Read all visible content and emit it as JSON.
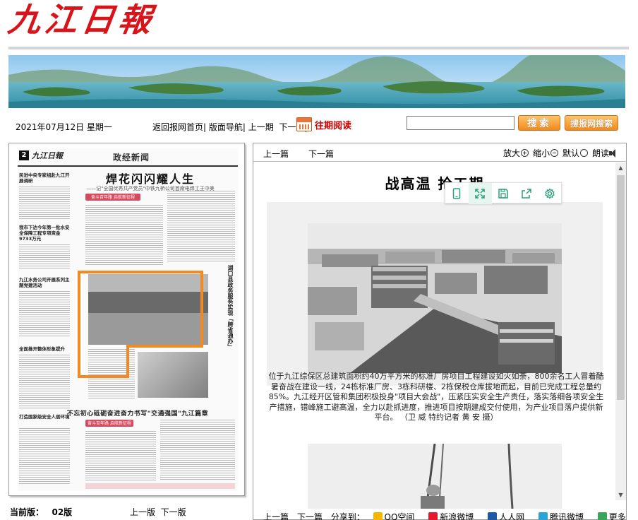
{
  "masthead": {
    "logo": "九江日報"
  },
  "topnav": {
    "date": "2021年07月12日 星期一",
    "links": [
      "返回报网首页|",
      "版面导航|",
      "上一期",
      "下一期|"
    ],
    "archive_label": "往期阅读",
    "search_value": "",
    "search_button": "搜索",
    "site_search_button": "搜报网搜索"
  },
  "newspage": {
    "page_num": "2",
    "logo": "九江日報",
    "section": "政经新闻",
    "headline": "焊花闪闪耀人生",
    "subhead": "——记\"全国优秀共产党员\"中铁九桥公司首席电焊工王中美",
    "side_heads": [
      "民进中央专家组赴九江开展调研",
      "我市下达今年第一批水安全保障工程专项资金9733万元",
      "九江水务公司开展系列主题党建活动",
      "全面推开整体形象提升",
      "打造国家级安全人居环境"
    ],
    "red_boxes": [
      "奋斗百年路 启航新征程",
      "奋斗百年路 启航新征程"
    ],
    "vertical_head": "湖口县政务服务实现「跨省通办」",
    "bottom_head": "不忘初心砥砺奋进奋力书写\"交通强国\"九江篇章"
  },
  "version": {
    "label": "当前版：",
    "value": "02版",
    "prev": "上一版",
    "next": "下一版"
  },
  "article_bar": {
    "prev": "上一篇",
    "next": "下一篇",
    "zoom_in": "放大",
    "zoom_out": "缩小",
    "default": "默认",
    "read": "朗读"
  },
  "article": {
    "title": "战高温 抢工期",
    "caption": "位于九江综保区总建筑面积约40万平方米的标准厂房项目工程建设如火如荼，800余名工人冒着酷暑奋战在建设一线，24栋标准厂房、3栋科研楼、2栋保税仓库拔地而起，目前已完成工程总量约85%。九江经开区管和集团积极投身\"项目大会战\"，压紧压实安全生产责任，落实落细各项安全生产措施，错峰施工避高温，全力以赴抓进度，推进项目按期建成交付使用，为产业项目落户提供新平台。 （卫 威 特约记者 黄 安 摄）"
  },
  "floating_tools": [
    "phone-icon",
    "fullscreen-icon",
    "save-icon",
    "share-icon",
    "gear-icon"
  ],
  "bottom_bar": {
    "prev": "上一篇",
    "next": "下一篇",
    "share_label": "分享到：",
    "shares": [
      "QQ空间",
      "新浪微博",
      "人人网",
      "腾讯微博",
      "更多"
    ]
  },
  "colors": {
    "brand_red": "#d8141a",
    "highlight_orange": "#f28a24",
    "tool_green": "#2aa07a"
  }
}
